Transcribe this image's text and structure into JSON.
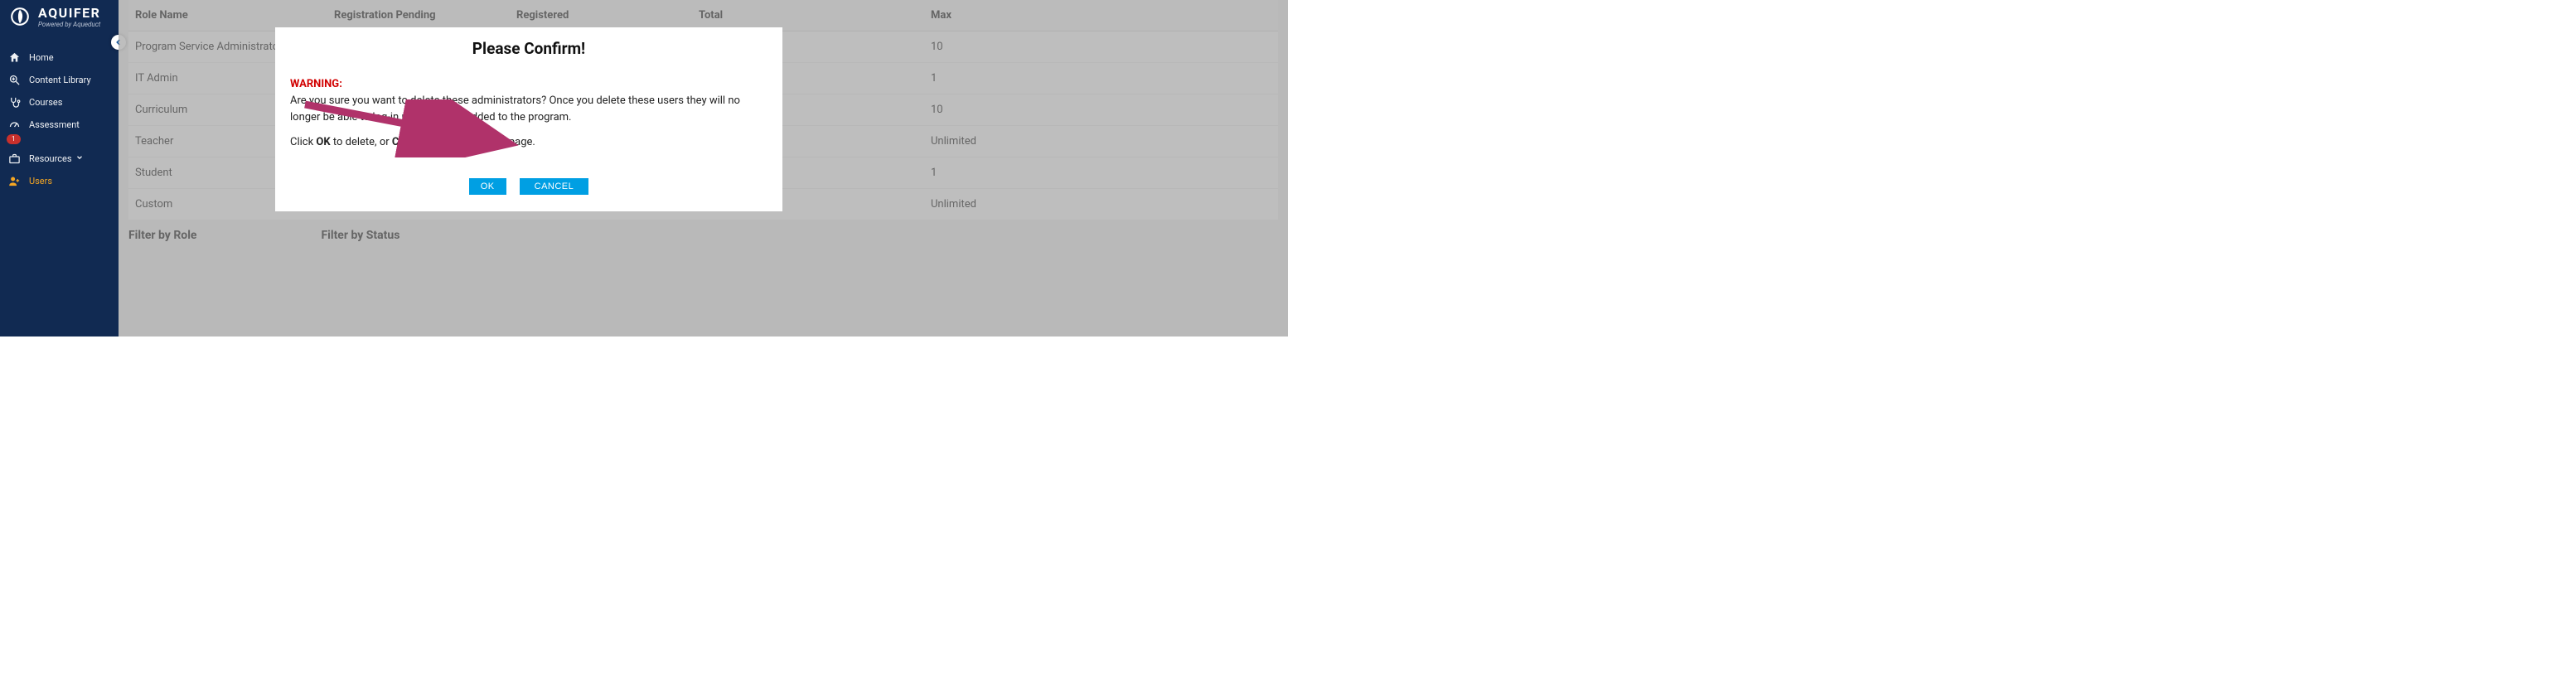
{
  "brand": {
    "name": "AQUIFER",
    "tagline": "Powered by Aqueduct"
  },
  "sidebar": {
    "items": [
      {
        "label": "Home",
        "icon": "home-icon"
      },
      {
        "label": "Content Library",
        "icon": "search-plus-icon"
      },
      {
        "label": "Courses",
        "icon": "stethoscope-icon"
      },
      {
        "label": "Assessment",
        "icon": "gauge-icon",
        "badge": "1"
      },
      {
        "label": "Resources",
        "icon": "briefcase-icon",
        "chev": true
      },
      {
        "label": "Users",
        "icon": "user-plus-icon",
        "active": true
      }
    ]
  },
  "table": {
    "headers": [
      "Role Name",
      "Registration Pending",
      "Registered",
      "Total",
      "Max"
    ],
    "rows": [
      {
        "role": "Program Service Administrator",
        "max": "10"
      },
      {
        "role": "IT Admin",
        "max": "1"
      },
      {
        "role": "Curriculum",
        "max": "10"
      },
      {
        "role": "Teacher",
        "max": "Unlimited"
      },
      {
        "role": "Student",
        "max": "1"
      },
      {
        "role": "Custom",
        "max": "Unlimited"
      }
    ]
  },
  "filters": {
    "role_label": "Filter by Role",
    "status_label": "Filter by Status"
  },
  "modal": {
    "title": "Please Confirm!",
    "warning_label": "WARNING",
    "body_line1": "Are you sure you want to delete these administrators? Once you delete these users they will no longer be able to log-in until they are added to the program.",
    "body_click": "Click ",
    "body_ok_strong": "OK",
    "body_mid": " to delete, or ",
    "body_cancel_strong": "CANCEL",
    "body_end": " to return to the page.",
    "ok_label": "OK",
    "cancel_label": "CANCEL"
  }
}
